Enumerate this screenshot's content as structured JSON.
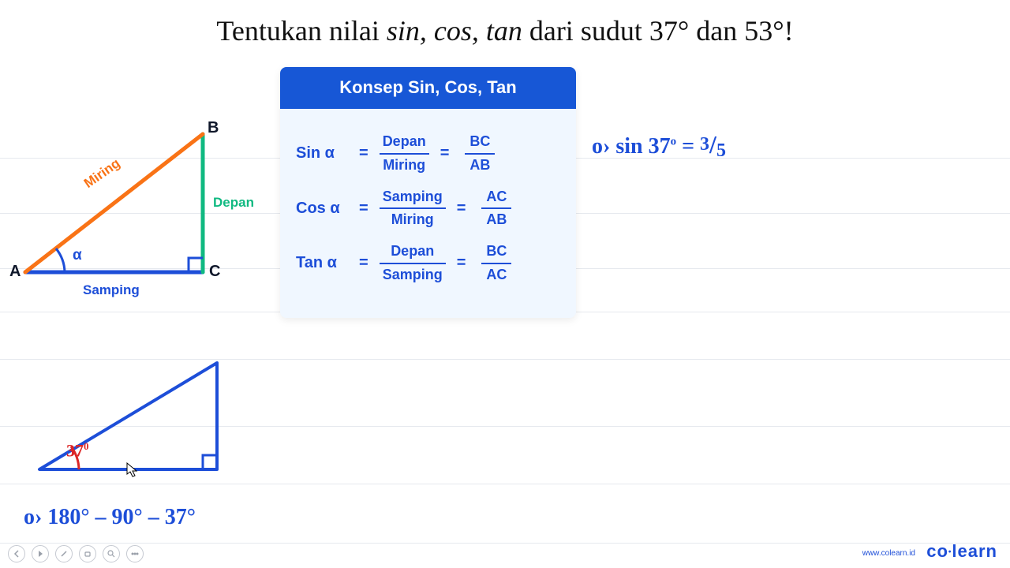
{
  "title": {
    "pre": "Tentukan nilai ",
    "ital": "sin, cos, tan",
    "post": " dari sudut 37° dan 53°!"
  },
  "triangle1": {
    "A": "A",
    "B": "B",
    "C": "C",
    "miring": "Miring",
    "depan": "Depan",
    "samping": "Samping",
    "alpha": "α"
  },
  "triangle2": {
    "angle": "37",
    "deg": "0"
  },
  "card": {
    "header": "Konsep Sin, Cos, Tan",
    "rows": [
      {
        "name": "Sin α",
        "eq": "=",
        "num": "Depan",
        "den": "Miring",
        "eq2": "=",
        "snum": "BC",
        "sden": "AB"
      },
      {
        "name": "Cos α",
        "eq": "=",
        "num": "Samping",
        "den": "Miring",
        "eq2": "=",
        "snum": "AC",
        "sden": "AB"
      },
      {
        "name": "Tan α",
        "eq": "=",
        "num": "Depan",
        "den": "Samping",
        "eq2": "=",
        "snum": "BC",
        "sden": "AC"
      }
    ]
  },
  "hand": {
    "eq_bottom": "o› 180° – 90° – 37°",
    "eq_right_pre": "o› sin 37",
    "eq_right_sup": "o",
    "eq_right_mid": " = ",
    "eq_right_n": "3",
    "eq_right_d": "5"
  },
  "footer": {
    "url": "www.colearn.id",
    "brand_a": "co",
    "brand_b": "learn"
  }
}
